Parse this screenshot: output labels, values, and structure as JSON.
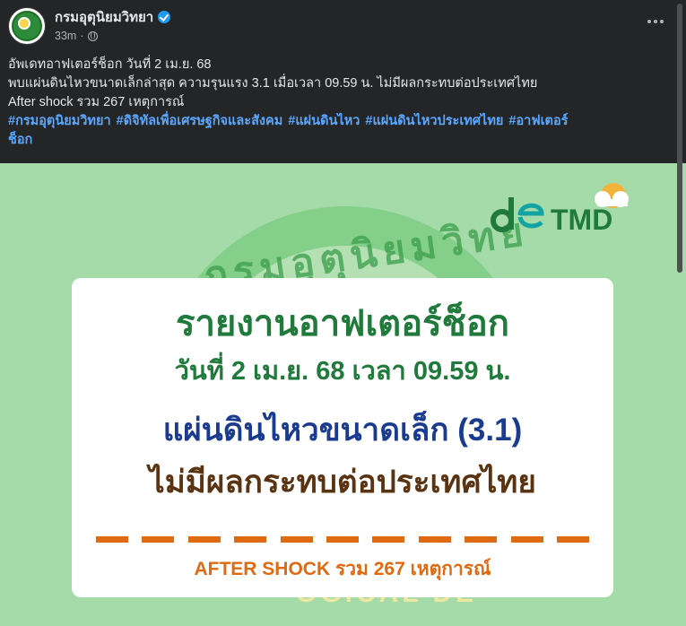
{
  "post": {
    "page_name": "กรมอุตุนิยมวิทยา",
    "time": "33m",
    "separator": "·",
    "more_icon": "more-horizontal-icon",
    "text_lines": [
      "อัพเดทอาฟเตอร์ช็อก วันที่ 2 เม.ย. 68",
      "พบแผ่นดินไหวขนาดเล็กล่าสุด ความรุนแรง 3.1 เมื่อเวลา 09.59 น. ไม่มีผลกระทบต่อประเทศไทย",
      "After shock รวม 267 เหตุการณ์"
    ],
    "hashtags": [
      "#กรมอุตุนิยมวิทยา",
      "#ดิจิทัลเพื่อเศรษฐกิจและสังคม",
      "#แผ่นดินไหว",
      "#แผ่นดินไหวประเทศไทย",
      "#อาฟเตอร์"
    ],
    "hashtag_wrap": "ช็อก",
    "link_color": "#5aa7ff"
  },
  "image": {
    "seal_text_top": "กรมอุตุนิยมวิทย",
    "seal_text_bottom": "OGICAL DE",
    "logo_left": "de",
    "logo_right": "TMD",
    "card": {
      "title": "รายงานอาฟเตอร์ช็อก",
      "date_line": "วันที่ 2 เม.ย. 68 เวลา 09.59 น.",
      "magnitude_line": "แผ่นดินไหวขนาดเล็ก (3.1)",
      "impact_line": "ไม่มีผลกระทบต่อประเทศไทย",
      "aftershock_line": "AFTER SHOCK รวม 267 เหตุการณ์"
    },
    "colors": {
      "background": "#a4dba8",
      "title_green": "#1f7a3b",
      "magnitude_blue": "#1a3b8f",
      "impact_brown": "#5a3412",
      "accent_orange": "#e06a12"
    }
  }
}
